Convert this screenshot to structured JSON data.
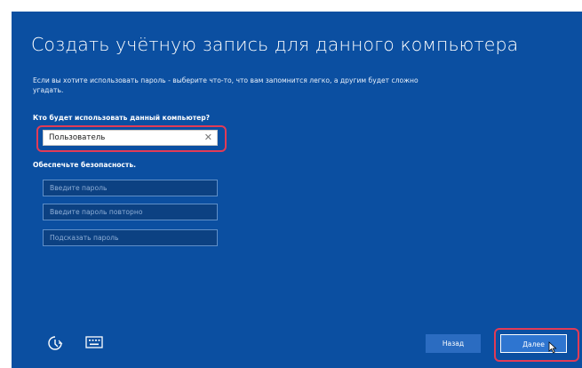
{
  "title": "Создать учётную запись для данного компьютера",
  "description": "Если вы хотите использовать пароль - выберите что-то, что вам запомнится легко, а другим будет сложно угадать.",
  "question": "Кто будет использовать данный компьютер?",
  "username": {
    "value": "Пользователь",
    "clear_glyph": "✕"
  },
  "security_label": "Обеспечьте безопасность.",
  "fields": {
    "password": "Введите пароль",
    "password_repeat": "Введите пароль повторно",
    "hint": "Подсказать пароль"
  },
  "buttons": {
    "back": "Назад",
    "next": "Далее"
  },
  "icons": {
    "accessibility": "ease-of-access-icon",
    "keyboard": "keyboard-icon"
  },
  "colors": {
    "background": "#0b4fa1",
    "highlight": "#e23b56",
    "button": "#2e75d0"
  }
}
